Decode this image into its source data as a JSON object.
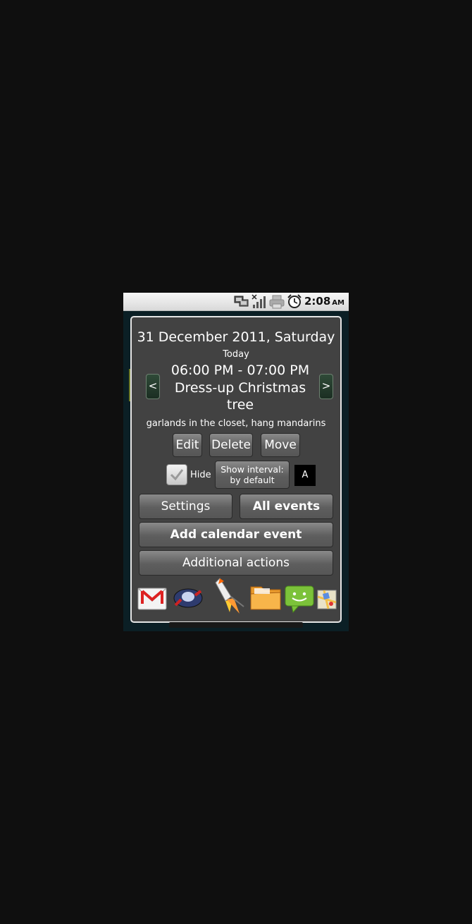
{
  "status_bar": {
    "time": "2:08",
    "ampm": "AM",
    "icons": [
      "network-icon",
      "signal-icon",
      "printer-icon",
      "alarm-icon"
    ]
  },
  "dialog": {
    "date_title": "31 December 2011, Saturday",
    "today_label": "Today",
    "prev_label": "<",
    "next_label": ">",
    "event_time": "06:00 PM - 07:00 PM",
    "event_title": "Dress-up Christmas tree",
    "event_description": "garlands in the closet, hang mandarins",
    "buttons": {
      "edit": "Edit",
      "delete": "Delete",
      "move": "Move",
      "settings": "Settings",
      "all_events": "All events",
      "add_calendar_event": "Add calendar event",
      "additional_actions": "Additional actions"
    },
    "hide_label": "Hide",
    "hide_checked": true,
    "interval_line1": "Show interval:",
    "interval_line2": "by default",
    "a_label": "A",
    "app_icons": [
      "gmail-icon",
      "rocket-ship-icon",
      "rocket-launch-icon",
      "folder-icon",
      "messaging-icon",
      "maps-icon"
    ]
  },
  "colors": {
    "dialog_bg": "#424242",
    "dialog_border": "#e6e6e6",
    "nav_button": "#2f4a38"
  }
}
